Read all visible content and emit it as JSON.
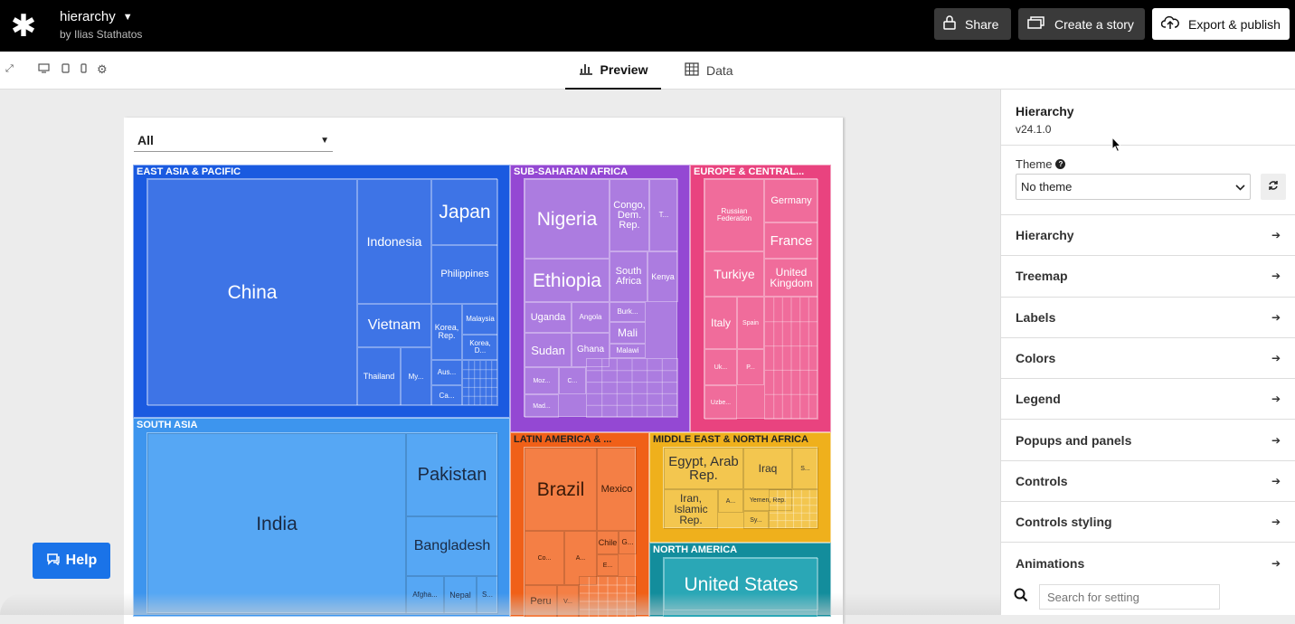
{
  "header": {
    "title": "hierarchy",
    "author": "by Ilias Stathatos",
    "share": "Share",
    "story": "Create a story",
    "export": "Export & publish"
  },
  "tabs": {
    "preview": "Preview",
    "data": "Data"
  },
  "filter": {
    "value": "All"
  },
  "help": "Help",
  "panel": {
    "title": "Hierarchy",
    "version": "v24.1.0",
    "theme_label": "Theme",
    "theme_value": "No theme",
    "sections": [
      "Hierarchy",
      "Treemap",
      "Labels",
      "Colors",
      "Legend",
      "Popups and panels",
      "Controls",
      "Controls styling",
      "Animations"
    ],
    "search_placeholder": "Search for setting"
  },
  "colors": {
    "east_asia": "#2d6ae0",
    "south_asia": "#4ea0f3",
    "ssa": "#a46bd9",
    "europe": "#ec5b92",
    "latam": "#f47a3a",
    "mena": "#f0b62a",
    "na": "#26a3b3"
  },
  "treemap": {
    "regions": {
      "east_asia": "EAST ASIA & PACIFIC",
      "south_asia": "SOUTH ASIA",
      "ssa": "SUB-SAHARAN AFRICA",
      "europe": "EUROPE & CENTRAL...",
      "latam": "LATIN AMERICA & ...",
      "mena": "MIDDLE EAST & NORTH AFRICA",
      "na": "NORTH AMERICA"
    },
    "east_asia": [
      "China",
      "Indonesia",
      "Japan",
      "Philippines",
      "Vietnam",
      "Korea, Rep.",
      "Malaysia",
      "Korea, D...",
      "Thailand",
      "My...",
      "Aus...",
      "Ca..."
    ],
    "south_asia": [
      "India",
      "Pakistan",
      "Bangladesh",
      "Afgha...",
      "Nepal",
      "S..."
    ],
    "ssa": [
      "Nigeria",
      "Congo, Dem. Rep.",
      "T...",
      "Ethiopia",
      "South Africa",
      "Kenya",
      "Uganda",
      "Angola",
      "Burk...",
      "Mali",
      "Sudan",
      "Ghana",
      "Malawi",
      "Moz...",
      "C...",
      "Mad..."
    ],
    "europe": [
      "Russian Federation",
      "Germany",
      "France",
      "Turkiye",
      "United Kingdom",
      "Italy",
      "Spain",
      "Uk...",
      "P...",
      "Uzbe..."
    ],
    "latam": [
      "Brazil",
      "Mexico",
      "Chile",
      "G...",
      "Co...",
      "A...",
      "E...",
      "Peru",
      "V..."
    ],
    "mena": [
      "Egypt, Arab Rep.",
      "Iraq",
      "S...",
      "Iran, Islamic Rep.",
      "A...",
      "Yemen, Rep.",
      "Sy..."
    ],
    "na": [
      "United States"
    ]
  }
}
